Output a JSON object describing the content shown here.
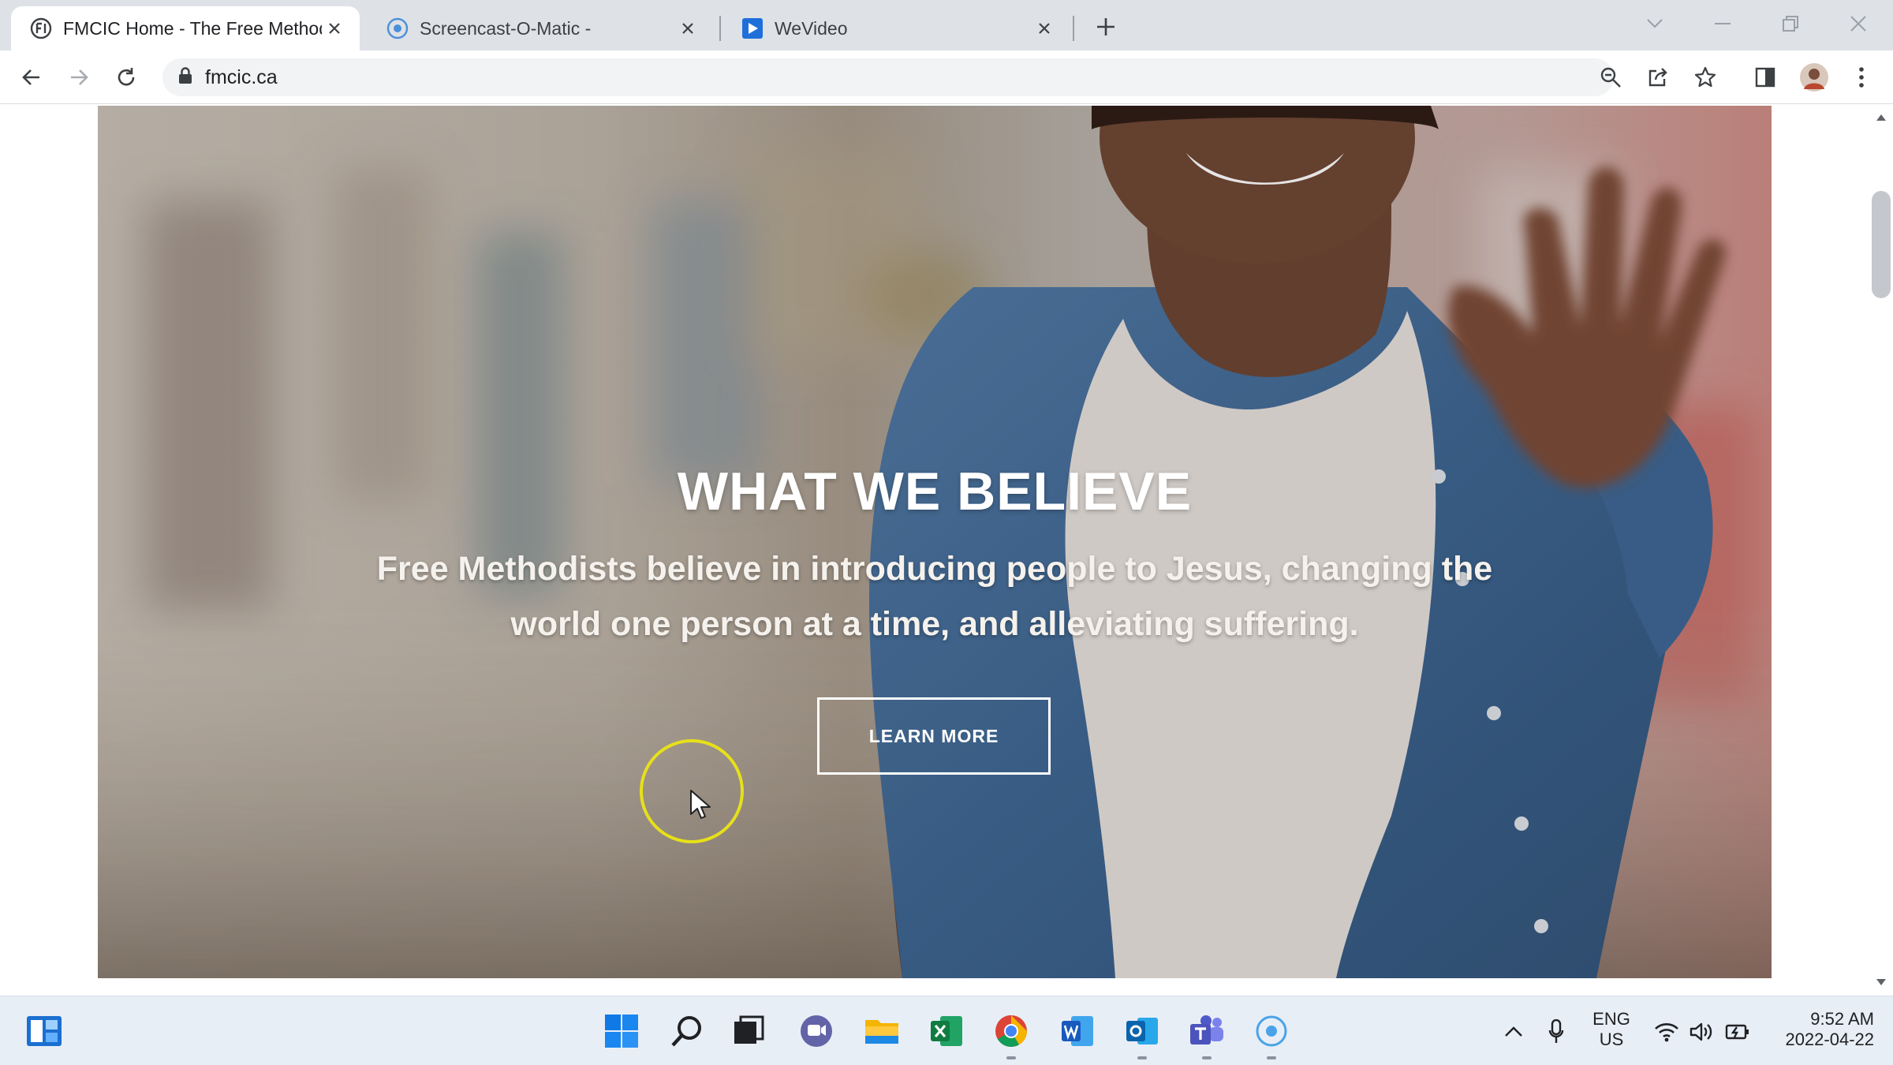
{
  "browser": {
    "tabs": [
      {
        "title": "FMCIC Home - The Free Methodi",
        "active": true
      },
      {
        "title": "Screencast-O-Matic -",
        "active": false
      },
      {
        "title": "WeVideo",
        "active": false
      }
    ],
    "new_tab_label": "+",
    "url": "fmcic.ca"
  },
  "hero": {
    "title": "WHAT WE BELIEVE",
    "text": "Free Methodists believe in introducing people to Jesus, changing the world one person at a time, and alleviating suffering.",
    "button_label": "LEARN MORE"
  },
  "taskbar": {
    "apps": [
      "widgets-icon",
      "start-icon",
      "search-icon",
      "task-view-icon",
      "chat-icon",
      "file-explorer-icon",
      "excel-icon",
      "chrome-icon",
      "word-icon",
      "outlook-icon",
      "teams-icon",
      "screencast-icon"
    ],
    "language_line1": "ENG",
    "language_line2": "US",
    "time": "9:52 AM",
    "date": "2022-04-22"
  },
  "colors": {
    "accent_chrome": "#1a73e8",
    "cursor_highlight": "#e7e01a",
    "taskbar_bg": "#e8eef6"
  }
}
